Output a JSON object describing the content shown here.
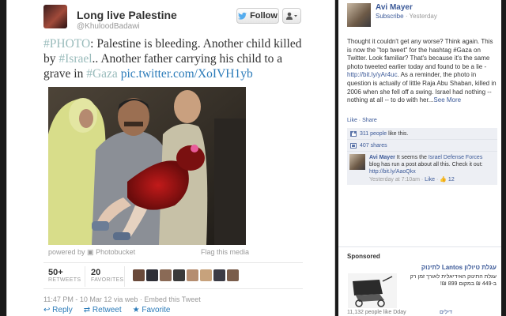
{
  "tweet": {
    "author_name": "Long live Palestine",
    "author_handle": "@KhuloodBadawi",
    "follow_label": "Follow",
    "text_parts": [
      "#PHOTO",
      ": Palestine is bleeding. Another child killed by ",
      "#Israel",
      ".. Another father carrying his child to a grave in ",
      "#Gaza",
      " pic.twitter.com/XoIVH1yb"
    ],
    "powered_by": "powered by",
    "photo_service": "Photobucket",
    "flag_media": "Flag this media",
    "retweets_count": "50+",
    "retweets_label": "RETWEETS",
    "favorites_count": "20",
    "favorites_label": "FAVORITES",
    "timestamp": "11:47 PM - 10 Mar 12 via web · Embed this Tweet",
    "actions": [
      "Reply",
      "Retweet",
      "Favorite"
    ],
    "face_colors": [
      "#6a4a3a",
      "#2e2e36",
      "#8a6a56",
      "#3a3a3a",
      "#b58d70",
      "#c7a27c",
      "#3b3b45",
      "#7a5d4b"
    ]
  },
  "facebook": {
    "author": "Avi Mayer",
    "subscribe": "Subscribe",
    "time": "· Yesterday",
    "body_parts": [
      "Thought it couldn't get any worse? Think again. This is now the \"top tweet\" for the hashtag #Gaza on Twitter. Look familiar? That's because it's the same photo tweeted earlier today and found to be a lie - ",
      "http://bit.ly/yAr4uc",
      ". As a reminder, the photo in question is actually of little Raja Abu Shaban, killed in 2006 when she fell off a swing. Israel had nothing -- nothing at all -- to do with her...",
      "See More"
    ],
    "like_share": [
      "Like",
      "Share"
    ],
    "likes": "311 people",
    "likes_suffix": " like this.",
    "shares": "407 shares",
    "comment_author": "Avi Mayer",
    "comment_text_parts": [
      " It seems the ",
      "Israel Defense Forces",
      " blog has run a post about all this. Check it out: ",
      "http://bit.ly/AaoQkx"
    ],
    "comment_time": "Yesterday at 7:10am · ",
    "comment_like": "Like",
    "comment_likes": "12",
    "sponsored": "Sponsored",
    "ad_title": "עגלת טיולון Lantos לתינוק",
    "ad_text": "עגלת התינוק האידיאלית לאורך זמן רק ב-449 ₪ במקום 899 ₪!",
    "ad_foot": "11,132 people like Dday",
    "ad_foot2": "דילים"
  }
}
